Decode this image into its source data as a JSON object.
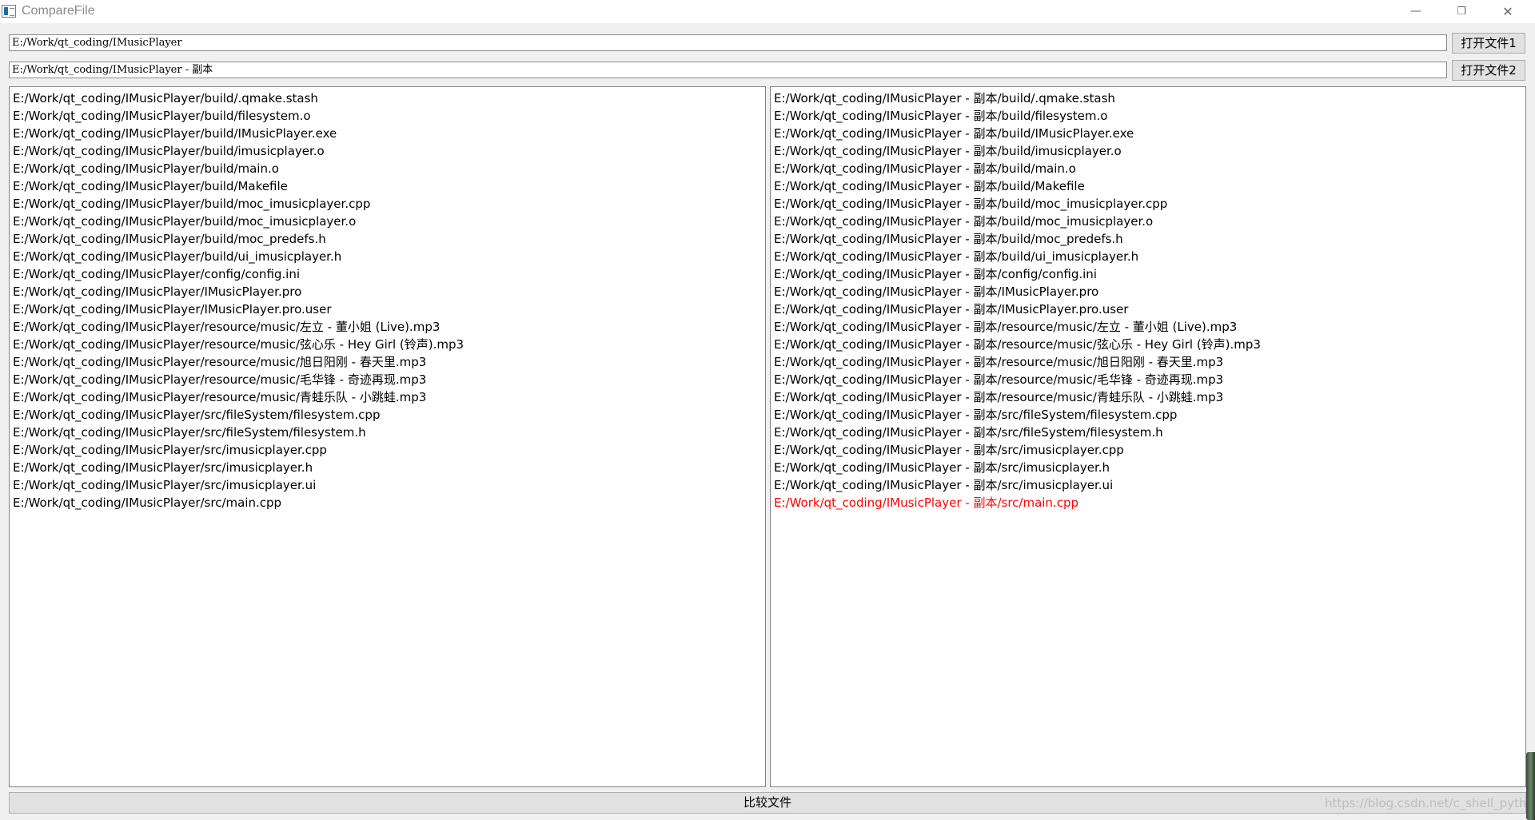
{
  "window": {
    "title": "CompareFile",
    "minimize_glyph": "—",
    "maximize_glyph": "❐",
    "close_glyph": "✕"
  },
  "inputs": {
    "path1": "E:/Work/qt_coding/IMusicPlayer",
    "path2": "E:/Work/qt_coding/IMusicPlayer - 副本"
  },
  "buttons": {
    "open1": "打开文件1",
    "open2": "打开文件2",
    "compare": "比较文件"
  },
  "left_list": [
    "E:/Work/qt_coding/IMusicPlayer/build/.qmake.stash",
    "E:/Work/qt_coding/IMusicPlayer/build/filesystem.o",
    "E:/Work/qt_coding/IMusicPlayer/build/IMusicPlayer.exe",
    "E:/Work/qt_coding/IMusicPlayer/build/imusicplayer.o",
    "E:/Work/qt_coding/IMusicPlayer/build/main.o",
    "E:/Work/qt_coding/IMusicPlayer/build/Makefile",
    "E:/Work/qt_coding/IMusicPlayer/build/moc_imusicplayer.cpp",
    "E:/Work/qt_coding/IMusicPlayer/build/moc_imusicplayer.o",
    "E:/Work/qt_coding/IMusicPlayer/build/moc_predefs.h",
    "E:/Work/qt_coding/IMusicPlayer/build/ui_imusicplayer.h",
    "E:/Work/qt_coding/IMusicPlayer/config/config.ini",
    "E:/Work/qt_coding/IMusicPlayer/IMusicPlayer.pro",
    "E:/Work/qt_coding/IMusicPlayer/IMusicPlayer.pro.user",
    "E:/Work/qt_coding/IMusicPlayer/resource/music/左立 - 董小姐 (Live).mp3",
    "E:/Work/qt_coding/IMusicPlayer/resource/music/弦心乐 - Hey Girl (铃声).mp3",
    "E:/Work/qt_coding/IMusicPlayer/resource/music/旭日阳刚 - 春天里.mp3",
    "E:/Work/qt_coding/IMusicPlayer/resource/music/毛华锋 - 奇迹再现.mp3",
    "E:/Work/qt_coding/IMusicPlayer/resource/music/青蛙乐队 - 小跳蛙.mp3",
    "E:/Work/qt_coding/IMusicPlayer/src/fileSystem/filesystem.cpp",
    "E:/Work/qt_coding/IMusicPlayer/src/fileSystem/filesystem.h",
    "E:/Work/qt_coding/IMusicPlayer/src/imusicplayer.cpp",
    "E:/Work/qt_coding/IMusicPlayer/src/imusicplayer.h",
    "E:/Work/qt_coding/IMusicPlayer/src/imusicplayer.ui",
    "E:/Work/qt_coding/IMusicPlayer/src/main.cpp"
  ],
  "right_list": [
    "E:/Work/qt_coding/IMusicPlayer - 副本/build/.qmake.stash",
    "E:/Work/qt_coding/IMusicPlayer - 副本/build/filesystem.o",
    "E:/Work/qt_coding/IMusicPlayer - 副本/build/IMusicPlayer.exe",
    "E:/Work/qt_coding/IMusicPlayer - 副本/build/imusicplayer.o",
    "E:/Work/qt_coding/IMusicPlayer - 副本/build/main.o",
    "E:/Work/qt_coding/IMusicPlayer - 副本/build/Makefile",
    "E:/Work/qt_coding/IMusicPlayer - 副本/build/moc_imusicplayer.cpp",
    "E:/Work/qt_coding/IMusicPlayer - 副本/build/moc_imusicplayer.o",
    "E:/Work/qt_coding/IMusicPlayer - 副本/build/moc_predefs.h",
    "E:/Work/qt_coding/IMusicPlayer - 副本/build/ui_imusicplayer.h",
    "E:/Work/qt_coding/IMusicPlayer - 副本/config/config.ini",
    "E:/Work/qt_coding/IMusicPlayer - 副本/IMusicPlayer.pro",
    "E:/Work/qt_coding/IMusicPlayer - 副本/IMusicPlayer.pro.user",
    "E:/Work/qt_coding/IMusicPlayer - 副本/resource/music/左立 - 董小姐 (Live).mp3",
    "E:/Work/qt_coding/IMusicPlayer - 副本/resource/music/弦心乐 - Hey Girl (铃声).mp3",
    "E:/Work/qt_coding/IMusicPlayer - 副本/resource/music/旭日阳刚 - 春天里.mp3",
    "E:/Work/qt_coding/IMusicPlayer - 副本/resource/music/毛华锋 - 奇迹再现.mp3",
    "E:/Work/qt_coding/IMusicPlayer - 副本/resource/music/青蛙乐队 - 小跳蛙.mp3",
    "E:/Work/qt_coding/IMusicPlayer - 副本/src/fileSystem/filesystem.cpp",
    "E:/Work/qt_coding/IMusicPlayer - 副本/src/fileSystem/filesystem.h",
    "E:/Work/qt_coding/IMusicPlayer - 副本/src/imusicplayer.cpp",
    "E:/Work/qt_coding/IMusicPlayer - 副本/src/imusicplayer.h",
    "E:/Work/qt_coding/IMusicPlayer - 副本/src/imusicplayer.ui",
    "E:/Work/qt_coding/IMusicPlayer - 副本/src/main.cpp"
  ],
  "right_list_diff_indices": [
    23
  ],
  "colors": {
    "diff_text": "#ff0000"
  },
  "watermark": "https://blog.csdn.net/c_shell_python"
}
